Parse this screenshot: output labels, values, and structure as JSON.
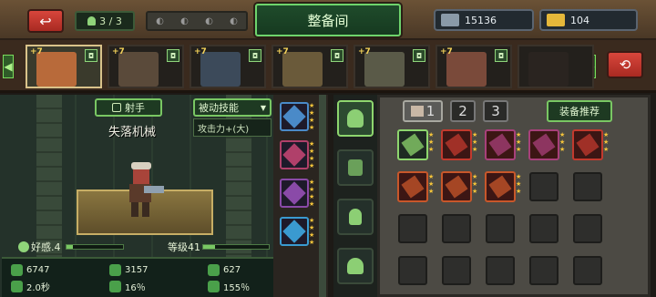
{
  "header": {
    "back_icon": "back-arrow-icon",
    "team_count": "3 / 3",
    "title": "整备间",
    "gems": "15136",
    "gold": "104"
  },
  "heroes": [
    {
      "star": "+7",
      "selected": true,
      "color": "#b86a3a"
    },
    {
      "star": "+7",
      "selected": false,
      "color": "#5a4a3a"
    },
    {
      "star": "+7",
      "selected": false,
      "color": "#3c4a5a"
    },
    {
      "star": "+7",
      "selected": false,
      "color": "#6a5a3a"
    },
    {
      "star": "+7",
      "selected": false,
      "color": "#5a5a48"
    },
    {
      "star": "+7",
      "selected": false,
      "color": "#7a4a3a"
    },
    {
      "star": "",
      "selected": false,
      "color": "#2a2420"
    }
  ],
  "hero": {
    "class": "射手",
    "name": "失落机械",
    "skill_dropdown": "被动技能",
    "skill_item": "攻击力+(大)",
    "favor_label": "好感.4",
    "level_label": "等级41",
    "favor_pct": 0.12,
    "level_pct": 0.18
  },
  "stats": {
    "hp": "6747",
    "atk": "3157",
    "def": "627",
    "speed": "2.0秒",
    "crit": "16％",
    "critdmg": "155％"
  },
  "inventory": {
    "tabs": [
      "1",
      "2",
      "3"
    ],
    "recommend": "装备推荐"
  },
  "colors": {
    "accent": "#79c763",
    "item_red": "#c23a2e",
    "item_orange": "#c8572a",
    "item_purple": "#a8407a",
    "equipped_green": "#8ed66e"
  }
}
